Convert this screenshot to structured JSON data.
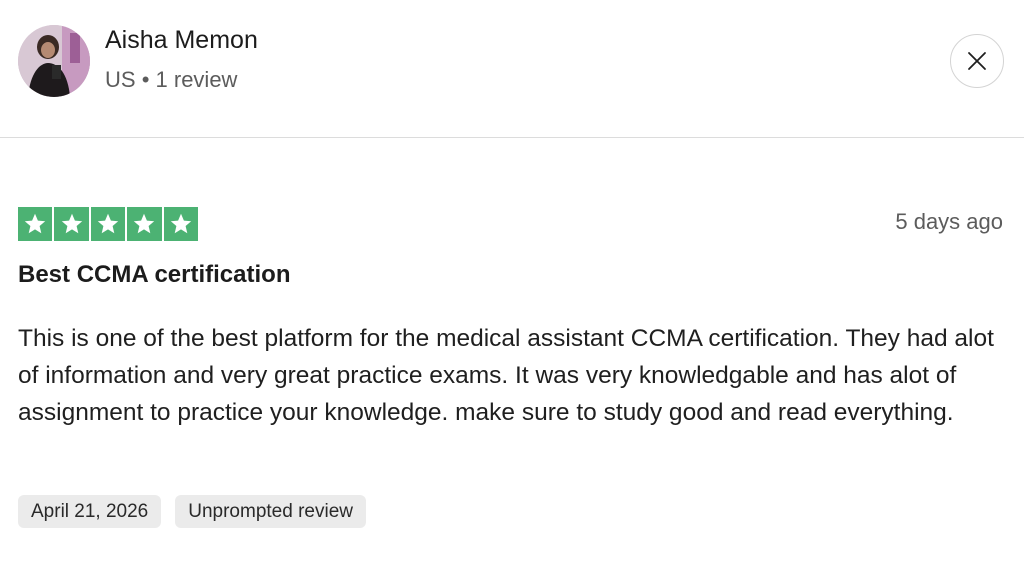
{
  "reviewer": {
    "name": "Aisha Memon",
    "country": "US",
    "separator": "•",
    "review_count": "1 review"
  },
  "close_button": {
    "icon": "close-icon"
  },
  "review": {
    "rating": 5,
    "rating_max": 5,
    "star_color": "#4cb273",
    "posted_ago": "5 days ago",
    "title": "Best CCMA certification",
    "body": "This is one of the best platform for the medical assistant CCMA certification. They had alot of information and very great practice exams. It was very knowledgable and has alot of assignment to practice your knowledge. make sure to study good and read everything.",
    "tags": [
      "April 21, 2026",
      "Unprompted review"
    ]
  }
}
